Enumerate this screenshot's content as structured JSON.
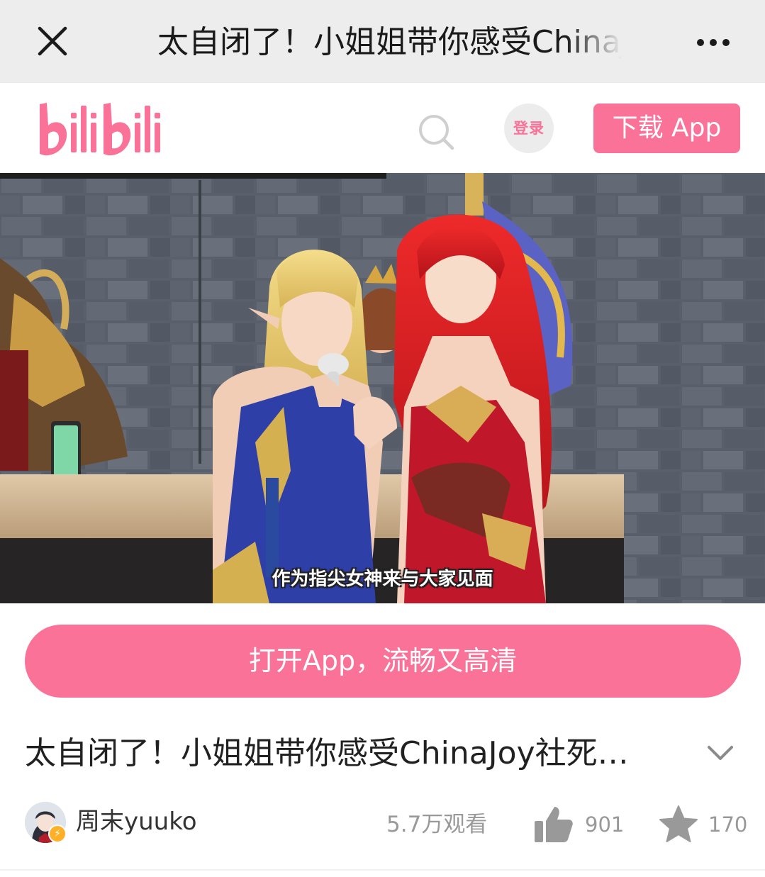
{
  "titlebar": {
    "title": "太自闭了！小姐姐带你感受ChinaJoy社死现场",
    "close_icon": "close-icon",
    "more_icon": "more-dots-icon"
  },
  "header": {
    "logo_text": "bilibili",
    "search_icon": "search-icon",
    "login_label": "登录",
    "download_label": "下载 App",
    "brand_color": "#fb7299"
  },
  "video": {
    "subtitle": "作为指尖女神来与大家见面"
  },
  "open_app": {
    "label": "打开App，流畅又高清"
  },
  "info": {
    "title": "太自闭了！小姐姐带你感受ChinaJoy社死…",
    "expand_icon": "chevron-down-icon",
    "uploader": "周末yuuko",
    "views": "5.7万观看",
    "likes": "901",
    "favorites": "170",
    "like_icon": "thumbs-up-icon",
    "favorite_icon": "star-icon"
  }
}
